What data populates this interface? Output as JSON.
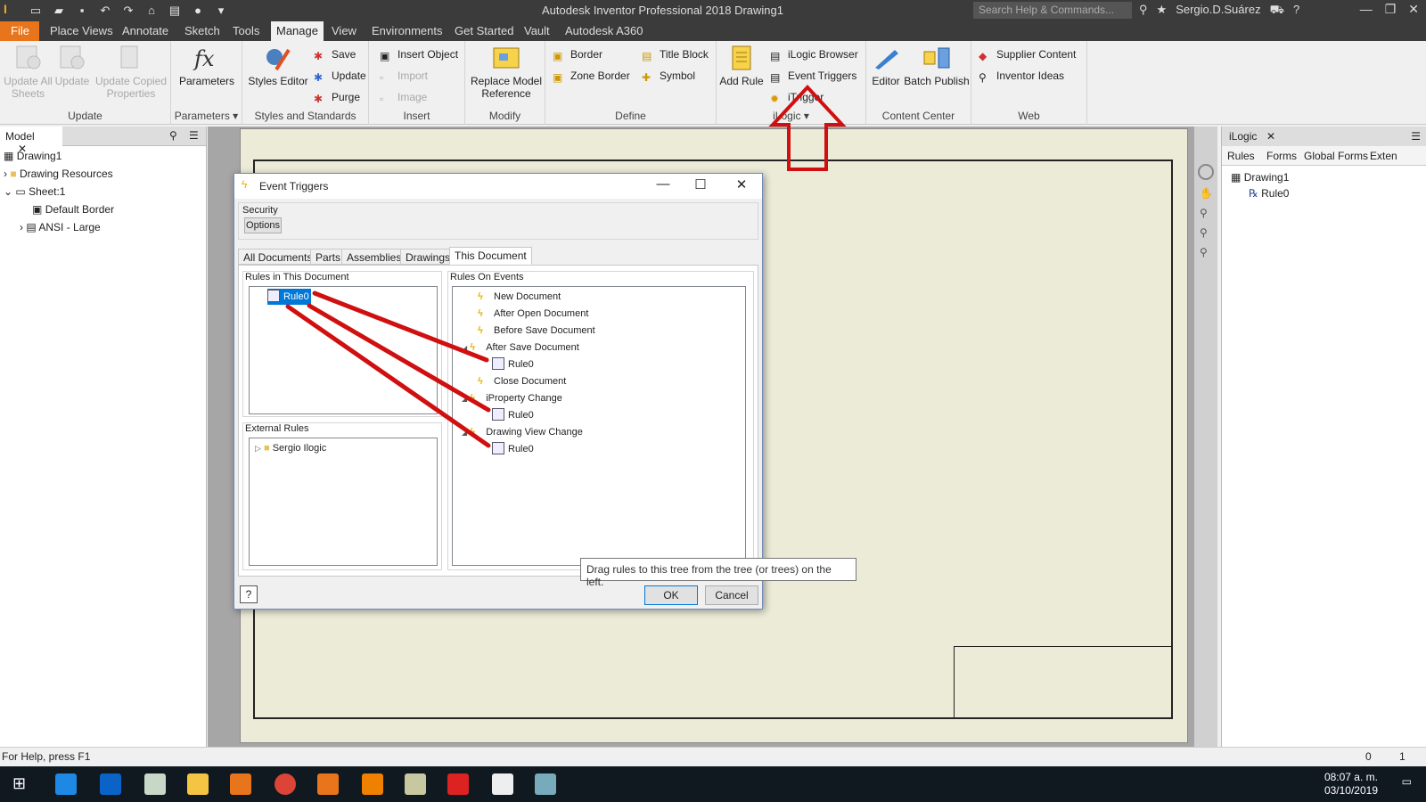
{
  "app": {
    "logo_letter": "I",
    "title": "Autodesk Inventor Professional 2018    Drawing1",
    "search_placeholder": "Search Help & Commands...",
    "user": "Sergio.D.Suárez",
    "window_controls": [
      "—",
      "❐",
      "✕"
    ]
  },
  "ribbon_tabs": [
    "File",
    "Place Views",
    "Annotate",
    "Sketch",
    "Tools",
    "Manage",
    "View",
    "Environments",
    "Get Started",
    "Vault",
    "Autodesk A360"
  ],
  "active_tab": "Manage",
  "ribbon": {
    "update": {
      "title": "Update",
      "update_all": "Update All Sheets",
      "update": "Update",
      "update_copied": "Update Copied Properties"
    },
    "parameters": {
      "title": "Parameters",
      "parameters": "Parameters"
    },
    "styles": {
      "title": "Styles and Standards",
      "styles_editor": "Styles Editor",
      "save": "Save",
      "update": "Update",
      "purge": "Purge"
    },
    "insert": {
      "title": "Insert",
      "insert_object": "Insert Object",
      "import": "Import",
      "image": "Image"
    },
    "modify": {
      "title": "Modify",
      "replace_model": "Replace Model Reference"
    },
    "define": {
      "title": "Define",
      "border": "Border",
      "zone_border": "Zone Border",
      "title_block": "Title Block",
      "symbol": "Symbol"
    },
    "ilogic": {
      "title": "iLogic",
      "add_rule": "Add Rule",
      "browser": "iLogic Browser",
      "event_triggers": "Event Triggers",
      "itrigger": "iTrigger"
    },
    "content_center": {
      "title": "Content Center",
      "editor": "Editor",
      "batch_publish": "Batch Publish"
    },
    "web": {
      "title": "Web",
      "supplier": "Supplier Content",
      "ideas": "Inventor Ideas"
    }
  },
  "model_browser": {
    "tab": "Model",
    "items": [
      "Drawing1",
      "Drawing Resources",
      "Sheet:1",
      "Default Border",
      "ANSI - Large"
    ]
  },
  "ilogic_panel": {
    "header": "iLogic",
    "tabs": [
      "Rules",
      "Forms",
      "Global Forms",
      "Exten"
    ],
    "items": [
      "Drawing1",
      "Rule0"
    ]
  },
  "dialog": {
    "title": "Event Triggers",
    "security_label": "Security",
    "options_button": "Options",
    "tabs": [
      "All Documents",
      "Parts",
      "Assemblies",
      "Drawings",
      "This Document"
    ],
    "active_tab": "This Document",
    "rules_in_doc_label": "Rules in This Document",
    "rules_in_doc": [
      "Rule0"
    ],
    "external_rules_label": "External Rules",
    "external_rules": [
      "Sergio Ilogic"
    ],
    "rules_on_events_label": "Rules On Events",
    "events": [
      {
        "label": "New Document",
        "kind": "event"
      },
      {
        "label": "After Open Document",
        "kind": "event"
      },
      {
        "label": "Before Save Document",
        "kind": "event"
      },
      {
        "label": "After Save Document",
        "kind": "event"
      },
      {
        "label": "Rule0",
        "kind": "rule"
      },
      {
        "label": "Close Document",
        "kind": "event"
      },
      {
        "label": "iProperty Change",
        "kind": "event"
      },
      {
        "label": "Rule0",
        "kind": "rule"
      },
      {
        "label": "Drawing View Change",
        "kind": "event"
      },
      {
        "label": "Rule0",
        "kind": "rule"
      }
    ],
    "ok": "OK",
    "cancel": "Cancel",
    "tooltip": "Drag rules to this tree from the tree (or trees) on the left."
  },
  "status": {
    "help": "For Help, press F1",
    "count1": "0",
    "count2": "1"
  },
  "taskbar": {
    "time": "08:07 a. m.",
    "date": "03/10/2019"
  },
  "colors": {
    "accent": "#e8741c",
    "annotation": "#d01010",
    "sheet": "#ecebd8"
  }
}
